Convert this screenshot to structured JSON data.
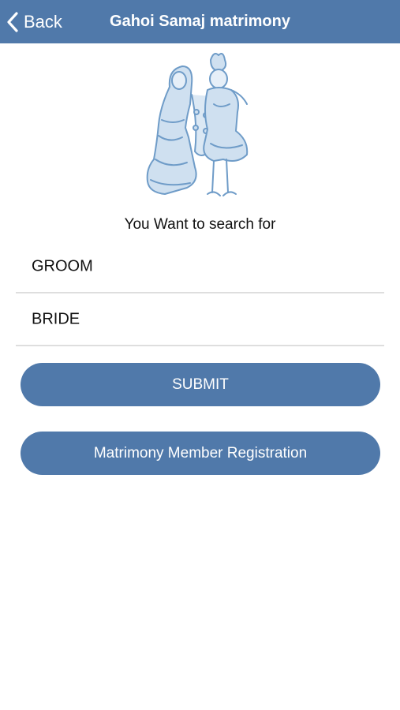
{
  "navbar": {
    "back_label": "Back",
    "title": "Gahoi Samaj matrimony",
    "background": "#5079aa"
  },
  "logo": {
    "icon": "bride-groom-illustration-icon"
  },
  "search": {
    "prompt": "You Want to search for",
    "options": [
      {
        "label": "GROOM"
      },
      {
        "label": "BRIDE"
      }
    ]
  },
  "actions": {
    "submit_label": "SUBMIT",
    "register_label": "Matrimony Member Registration",
    "button_color": "#5079aa"
  }
}
